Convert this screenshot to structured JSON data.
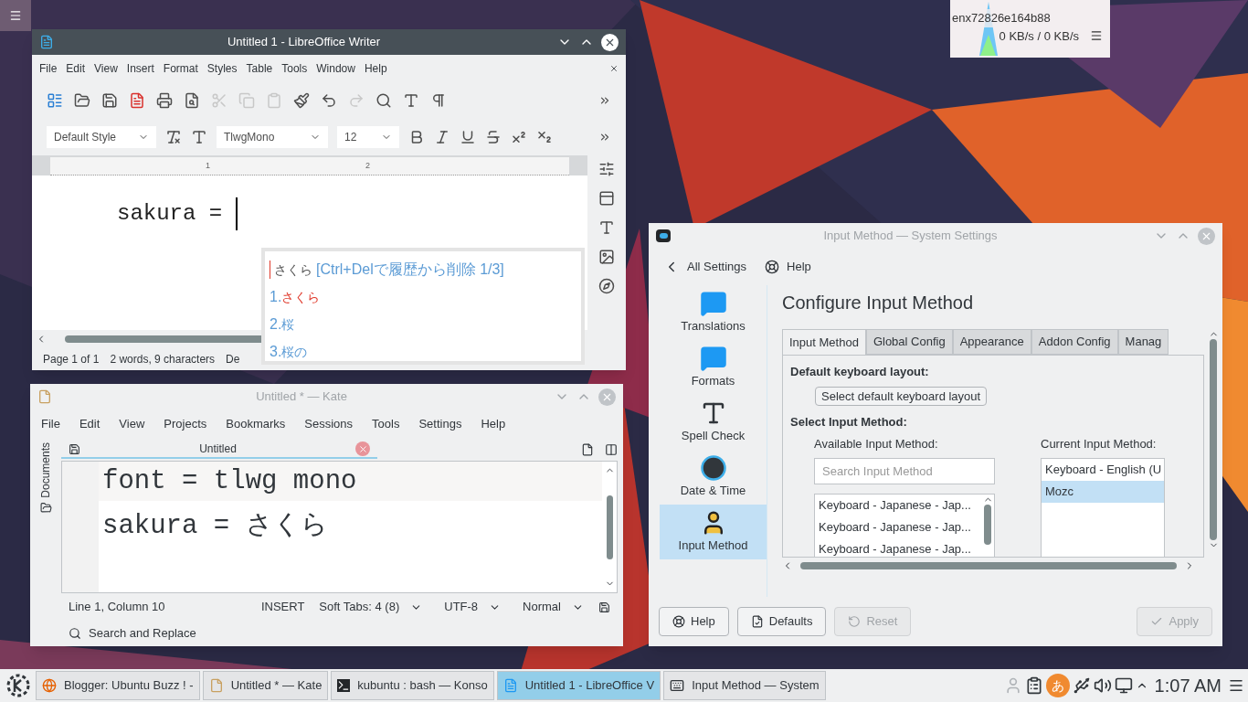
{
  "network_widget": {
    "interface": "enx72826e164b88",
    "rate": "0 KB/s / 0 KB/s"
  },
  "writer": {
    "title": "Untitled 1 - LibreOffice Writer",
    "menu": [
      "File",
      "Edit",
      "View",
      "Insert",
      "Format",
      "Styles",
      "Table",
      "Tools",
      "Window",
      "Help"
    ],
    "paragraph_style": "Default Style",
    "font_name": "TlwgMono",
    "font_size": "12",
    "ruler_marks": [
      "1",
      "2"
    ],
    "document_text": "sakura =",
    "status": [
      "Page 1 of 1",
      "2 words, 9 characters",
      "De"
    ]
  },
  "candidate_popup": {
    "preedit": "さくら",
    "hint": "[Ctrl+Delで履歴から削除 1/3]",
    "candidates": [
      {
        "number": "1.",
        "text": "さくら",
        "selected": true
      },
      {
        "number": "2.",
        "text": "桜",
        "selected": false
      },
      {
        "number": "3.",
        "text": "桜の",
        "selected": false
      }
    ]
  },
  "kate": {
    "title": "Untitled * — Kate",
    "menu": [
      "File",
      "Edit",
      "View",
      "Projects",
      "Bookmarks",
      "Sessions",
      "Tools",
      "Settings",
      "Help"
    ],
    "sidebar_tab": "Documents",
    "tab": "Untitled",
    "lines": [
      "font = tlwg mono",
      "sakura = さくら"
    ],
    "status": {
      "position": "Line 1, Column 10",
      "mode": "INSERT",
      "tabs": "Soft Tabs: 4 (8)",
      "encoding": "UTF-8",
      "syntax": "Normal"
    },
    "search": "Search and Replace"
  },
  "settings": {
    "title": "Input Method  — System Settings",
    "back": "All Settings",
    "help": "Help",
    "heading": "Configure Input Method",
    "sidebar": [
      {
        "label": "Translations",
        "selected": false
      },
      {
        "label": "Formats",
        "selected": false
      },
      {
        "label": "Spell Check",
        "selected": false
      },
      {
        "label": "Date & Time",
        "selected": false
      },
      {
        "label": "Input Method",
        "selected": true
      }
    ],
    "tabs": [
      {
        "label": "Input Method",
        "selected": true
      },
      {
        "label": "Global Config",
        "selected": false
      },
      {
        "label": "Appearance",
        "selected": false
      },
      {
        "label": "Addon Config",
        "selected": false
      },
      {
        "label": "Manag",
        "selected": false
      }
    ],
    "keyboard_section": "Default keyboard layout:",
    "keyboard_button": "Select default keyboard layout",
    "method_section": "Select Input Method:",
    "available_label": "Available Input Method:",
    "search_placeholder": "Search Input Method",
    "available": [
      "Keyboard - Japanese - Jap...",
      "Keyboard - Japanese - Jap...",
      "Keyboard - Japanese - Jap..."
    ],
    "current_label": "Current Input Method:",
    "current": [
      {
        "label": "Keyboard - English (U",
        "selected": false
      },
      {
        "label": "Mozc",
        "selected": true
      }
    ],
    "buttons": [
      {
        "label": "Help",
        "disabled": false
      },
      {
        "label": "Defaults",
        "disabled": false
      },
      {
        "label": "Reset",
        "disabled": true
      },
      {
        "label": "Apply",
        "disabled": true
      }
    ]
  },
  "taskbar": {
    "tasks": [
      {
        "label": "Blogger: Ubuntu Buzz ! -",
        "selected": false
      },
      {
        "label": "Untitled * — Kate",
        "selected": false
      },
      {
        "label": "kubuntu : bash — Konso",
        "selected": false
      },
      {
        "label": "Untitled 1 - LibreOffice V",
        "selected": true
      },
      {
        "label": "Input Method  — System",
        "selected": false
      }
    ],
    "ime_indicator": "あ",
    "clock": "1:07 AM"
  }
}
